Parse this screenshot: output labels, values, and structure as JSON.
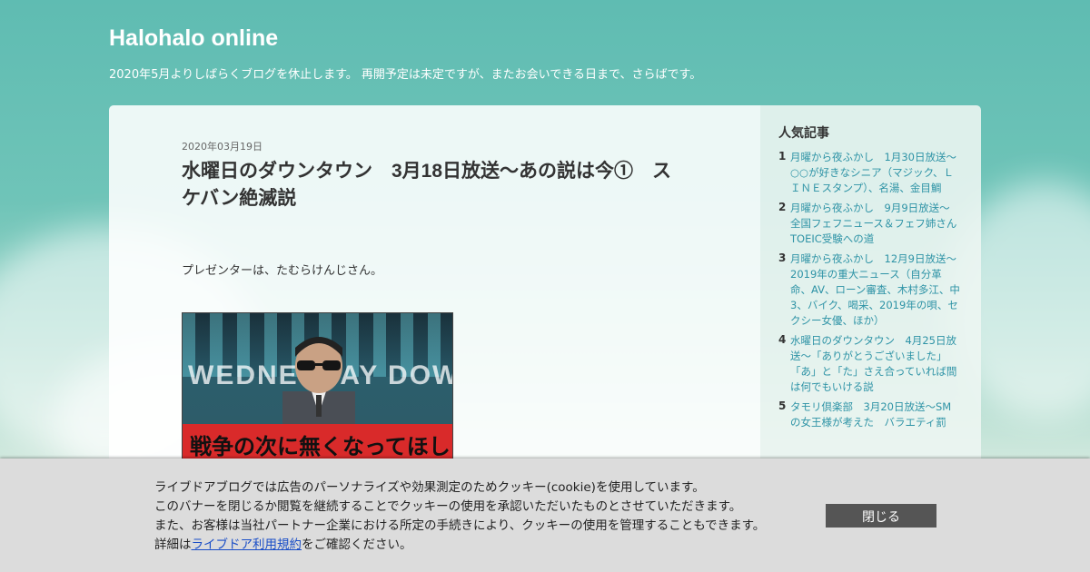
{
  "header": {
    "title": "Halohalo online",
    "description": "2020年5月よりしばらくブログを休止します。 再開予定は未定ですが、またお会いできる日まで、さらばです。"
  },
  "post": {
    "date": "2020年03月19日",
    "title": "水曜日のダウンタウン　3月18日放送～あの説は今①　スケバン絶滅説",
    "text": "プレゼンターは、たむらけんじさん。",
    "image": {
      "background_letters": "WEDNESDAY DOWNTOWN",
      "caption": "戦争の次に無くなってほしい"
    }
  },
  "sidebar": {
    "title": "人気記事",
    "items": [
      {
        "rank": "1",
        "label": "月曜から夜ふかし　1月30日放送～○○が好きなシニア（マジック、ＬＩＮＥスタンプ）、名湯、金目鯛"
      },
      {
        "rank": "2",
        "label": "月曜から夜ふかし　9月9日放送～全国フェフニュース＆フェフ姉さんTOEIC受験への道"
      },
      {
        "rank": "3",
        "label": "月曜から夜ふかし　12月9日放送～2019年の重大ニュース（自分革命、AV、ローン審査、木村多江、中3、バイク、喝采、2019年の唄、セクシー女優、ほか）"
      },
      {
        "rank": "4",
        "label": "水曜日のダウンタウン　4月25日放送～「ありがとうございました」「あ」と「た」さえ合っていれば間は何でもいける説"
      },
      {
        "rank": "5",
        "label": "タモリ倶楽部　3月20日放送～SMの女王様が考えた　バラエティ罰"
      }
    ]
  },
  "cookie": {
    "line1": "ライブドアブログでは広告のパーソナライズや効果測定のためクッキー(cookie)を使用しています。",
    "line2": "このバナーを閉じるか閲覧を継続することでクッキーの使用を承認いただいたものとさせていただきます。",
    "line3": "また、お客様は当社パートナー企業における所定の手続きにより、クッキーの使用を管理することもできます。",
    "line4_prefix": "詳細は",
    "line4_link": "ライブドア利用規約",
    "line4_suffix": "をご確認ください。",
    "close_label": "閉じる"
  }
}
